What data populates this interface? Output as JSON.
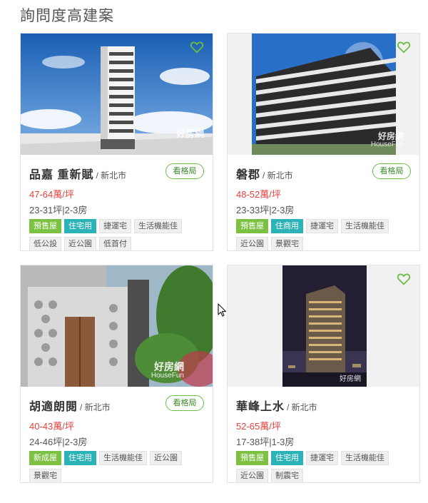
{
  "section_title": "詢問度高建案",
  "map_button_label": "看格局",
  "cards": [
    {
      "name": "品嘉 重新賦",
      "city": "/ 新北市",
      "price": "47-64萬/坪",
      "size": "23-31坪|2-3房",
      "tags": [
        {
          "label": "預售屋",
          "style": "green"
        },
        {
          "label": "住宅用",
          "style": "teal"
        },
        {
          "label": "捷運宅",
          "style": "plain"
        },
        {
          "label": "生活機能佳",
          "style": "plain"
        },
        {
          "label": "低公設",
          "style": "plain"
        },
        {
          "label": "近公園",
          "style": "plain"
        },
        {
          "label": "低首付",
          "style": "plain"
        }
      ]
    },
    {
      "name": "磐郡",
      "city": "/ 新北市",
      "price": "48-52萬/坪",
      "size": "23-33坪|2-3房",
      "tags": [
        {
          "label": "預售屋",
          "style": "green"
        },
        {
          "label": "住商用",
          "style": "teal"
        },
        {
          "label": "捷運宅",
          "style": "plain"
        },
        {
          "label": "生活機能佳",
          "style": "plain"
        },
        {
          "label": "近公園",
          "style": "plain"
        },
        {
          "label": "景觀宅",
          "style": "plain"
        }
      ]
    },
    {
      "name": "胡適朗閱",
      "city": "/ 新北市",
      "price": "40-43萬/坪",
      "size": "24-46坪|2-3房",
      "tags": [
        {
          "label": "新成屋",
          "style": "green"
        },
        {
          "label": "住宅用",
          "style": "teal"
        },
        {
          "label": "生活機能佳",
          "style": "plain"
        },
        {
          "label": "近公園",
          "style": "plain"
        },
        {
          "label": "景觀宅",
          "style": "plain"
        }
      ]
    },
    {
      "name": "華峰上水",
      "city": "/ 新北市",
      "price": "52-65萬/坪",
      "size": "17-38坪|1-3房",
      "tags": [
        {
          "label": "預售屋",
          "style": "green"
        },
        {
          "label": "住宅用",
          "style": "teal"
        },
        {
          "label": "捷運宅",
          "style": "plain"
        },
        {
          "label": "生活機能佳",
          "style": "plain"
        },
        {
          "label": "近公園",
          "style": "plain"
        },
        {
          "label": "制震宅",
          "style": "plain"
        }
      ]
    }
  ],
  "watermarks": [
    "好房網",
    "HouseFun"
  ],
  "colors": {
    "accent_green": "#7cc142",
    "accent_teal": "#2cb3b8",
    "price_red": "#e8413c",
    "heart_green": "#6abd45"
  }
}
